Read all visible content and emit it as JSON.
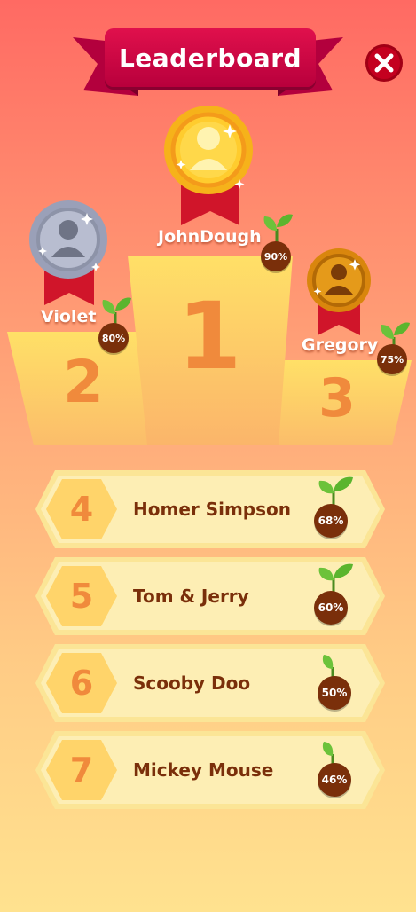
{
  "header": {
    "title": "Leaderboard",
    "close_icon": "close-icon"
  },
  "colors": {
    "title_plate": "#c8003f",
    "ribbon": "#a3003a",
    "podium": "#ffd86a",
    "rank_number": "#f08a3c",
    "badge": "#7a2f0a",
    "row_bg": "#fdeca8"
  },
  "podium": {
    "first": {
      "rank": "1",
      "name": "JohnDough",
      "percent": "90%",
      "medal": "gold-medal-icon"
    },
    "second": {
      "rank": "2",
      "name": "Violet",
      "percent": "80%",
      "medal": "silver-medal-icon"
    },
    "third": {
      "rank": "3",
      "name": "Gregory",
      "percent": "75%",
      "medal": "bronze-medal-icon"
    }
  },
  "list": [
    {
      "rank": "4",
      "name": "Homer Simpson",
      "percent": "68%"
    },
    {
      "rank": "5",
      "name": "Tom & Jerry",
      "percent": "60%"
    },
    {
      "rank": "6",
      "name": "Scooby Doo",
      "percent": "50%"
    },
    {
      "rank": "7",
      "name": "Mickey Mouse",
      "percent": "46%"
    }
  ]
}
